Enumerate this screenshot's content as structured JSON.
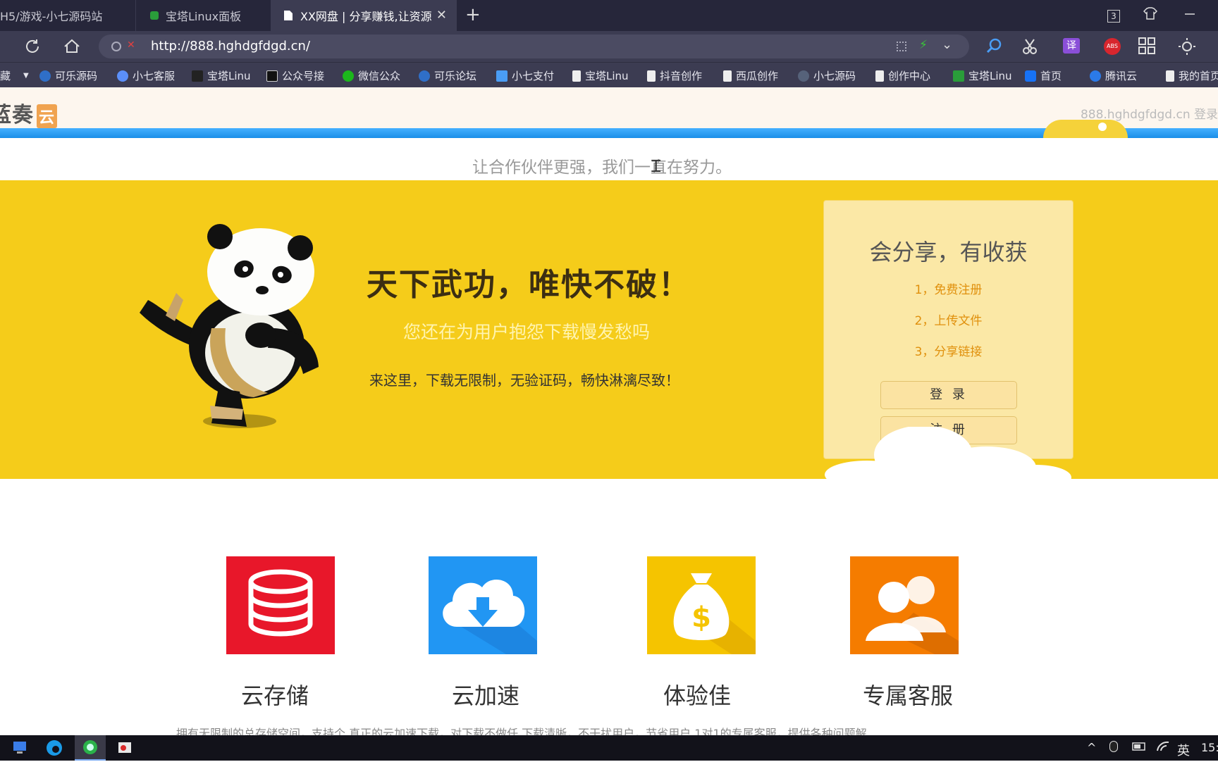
{
  "browser": {
    "tabs": [
      {
        "title": "H5/游戏-小七源码站",
        "active": false
      },
      {
        "title": "宝塔Linux面板",
        "active": false
      },
      {
        "title": "XX网盘 | 分享赚钱,让资源",
        "active": true
      }
    ],
    "tab_count": "3",
    "url": "http://888.hghdgfdgd.cn/",
    "bookmarks": [
      "藏",
      "可乐源码",
      "小七客服",
      "宝塔Linu",
      "公众号接",
      "微信公众",
      "可乐论坛",
      "小七支付",
      "宝塔Linu",
      "抖音创作",
      "西瓜创作",
      "小七源码",
      "创作中心",
      "宝塔Linu",
      "首页",
      "腾讯云",
      "我的首页"
    ],
    "translate_label": "译",
    "abs_label": "ABS"
  },
  "site": {
    "logo_text": "蓝奏",
    "logo_badge": "云",
    "header_right": "888.hghdgfdgd.cn 登录",
    "tagline": "让合作伙伴更强，我们一直在努力。"
  },
  "hero": {
    "title": "天下武功，唯快不破！",
    "subtitle": "您还在为用户抱怨下载慢发愁吗",
    "description": "来这里，下载无限制，无验证码，畅快淋漓尽致！"
  },
  "share_box": {
    "title": "会分享，有收获",
    "steps": [
      "1，免费注册",
      "2，上传文件",
      "3，分享链接"
    ],
    "login_label": "登 录",
    "register_label": "注 册"
  },
  "features": [
    {
      "label": "云存储",
      "icon": "database-icon",
      "color": "#e8172a"
    },
    {
      "label": "云加速",
      "icon": "cloud-download-icon",
      "color": "#2196f3"
    },
    {
      "label": "体验佳",
      "icon": "money-bag-icon",
      "color": "#f5c400"
    },
    {
      "label": "专属客服",
      "icon": "users-icon",
      "color": "#f57c00"
    }
  ],
  "features_desc": "拥有无限制的总存储空间，支持个   真正的云加速下载，对下载不做任   下载清晰，不干扰用户，节省用户   1对1的专属客服，提供各种问题解",
  "taskbar": {
    "ime": "英",
    "clock": "15:"
  }
}
